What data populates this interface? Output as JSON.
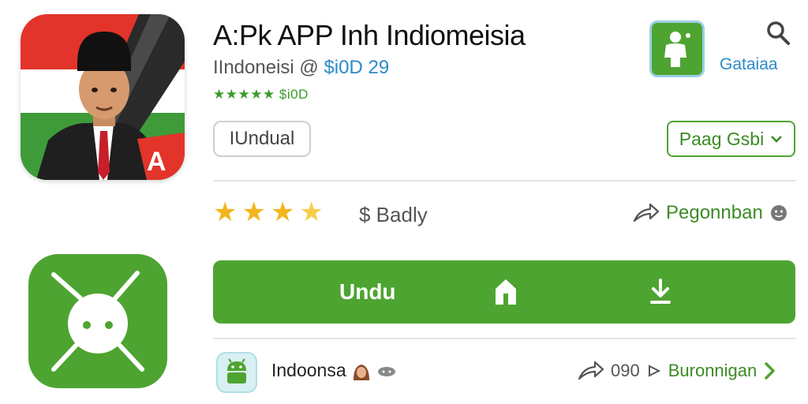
{
  "app": {
    "title": "A:Pk APP Inh Indiomeisia",
    "developer": "IIndoneisi @ ",
    "price": "$i0D 29",
    "mini_rating": "★★★★★ $i0D",
    "tag": "IUndual"
  },
  "badge": {
    "label": "Gataiaa"
  },
  "language_select": {
    "label": "Paag Gsbi"
  },
  "rating": {
    "stars": 4,
    "price_text": "$ Badly"
  },
  "share": {
    "label": "Pegonnban"
  },
  "install": {
    "label": "Undu"
  },
  "developer_row": {
    "name": "Indoonsa",
    "count": "090",
    "link_label": "Buronnigan"
  },
  "colors": {
    "accent_green": "#4ea431",
    "link_blue": "#2a8bc9",
    "star_yellow": "#f3b51d"
  }
}
